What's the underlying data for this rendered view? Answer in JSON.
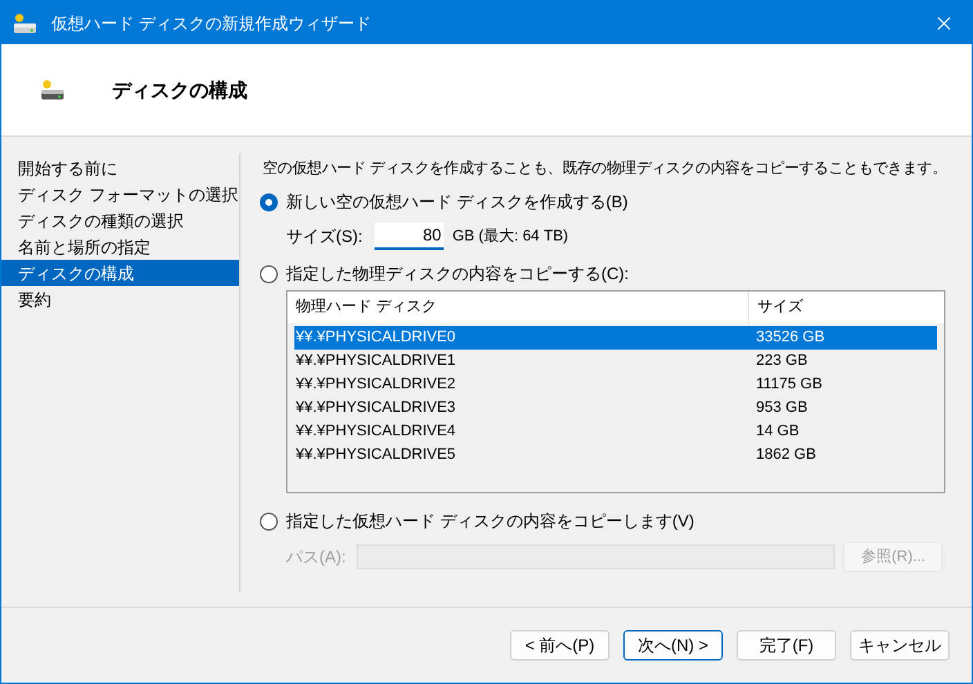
{
  "window": {
    "title": "仮想ハード ディスクの新規作成ウィザード"
  },
  "header": {
    "title": "ディスクの構成"
  },
  "steps": [
    {
      "label": "開始する前に",
      "selected": false
    },
    {
      "label": "ディスク フォーマットの選択",
      "selected": false
    },
    {
      "label": "ディスクの種類の選択",
      "selected": false
    },
    {
      "label": "名前と場所の指定",
      "selected": false
    },
    {
      "label": "ディスクの構成",
      "selected": true
    },
    {
      "label": "要約",
      "selected": false
    }
  ],
  "description": "空の仮想ハード ディスクを作成することも、既存の物理ディスクの内容をコピーすることもできます。",
  "option_new": {
    "label": "新しい空の仮想ハード ディスクを作成する(B)",
    "selected": true
  },
  "size": {
    "label": "サイズ(S):",
    "value": "80",
    "hint": "GB (最大: 64 TB)"
  },
  "option_physical": {
    "label": "指定した物理ディスクの内容をコピーする(C):",
    "selected": false
  },
  "disk_table": {
    "columns": [
      "物理ハード ディスク",
      "サイズ"
    ],
    "rows": [
      {
        "cells": [
          "¥¥.¥PHYSICALDRIVE0",
          "33526 GB"
        ],
        "selected": true
      },
      {
        "cells": [
          "¥¥.¥PHYSICALDRIVE1",
          "223 GB"
        ],
        "selected": false
      },
      {
        "cells": [
          "¥¥.¥PHYSICALDRIVE2",
          "11175 GB"
        ],
        "selected": false
      },
      {
        "cells": [
          "¥¥.¥PHYSICALDRIVE3",
          "953 GB"
        ],
        "selected": false
      },
      {
        "cells": [
          "¥¥.¥PHYSICALDRIVE4",
          "14 GB"
        ],
        "selected": false
      },
      {
        "cells": [
          "¥¥.¥PHYSICALDRIVE5",
          "1862 GB"
        ],
        "selected": false
      }
    ]
  },
  "option_virtual": {
    "label": "指定した仮想ハード ディスクの内容をコピーします(V)",
    "selected": false
  },
  "path": {
    "label": "パス(A):",
    "disabled": true,
    "browse_label": "参照(R)..."
  },
  "buttons": [
    {
      "label": "< 前へ(P)",
      "default": false
    },
    {
      "label": "次へ(N) >",
      "default": true
    },
    {
      "label": "完了(F)",
      "default": false
    },
    {
      "label": "キャンセル",
      "default": false
    }
  ]
}
